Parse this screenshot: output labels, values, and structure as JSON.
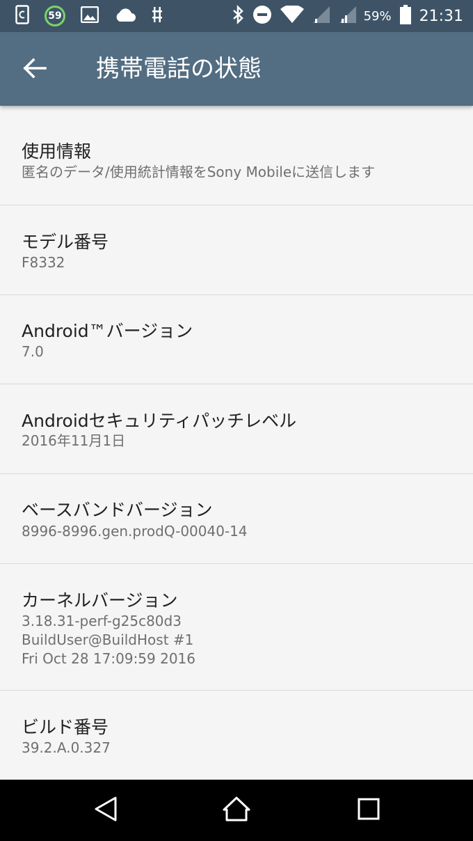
{
  "status_bar": {
    "notification_badge": "59",
    "battery_percent": "59%",
    "time": "21:31",
    "icons": [
      "screenshot-icon",
      "image-icon",
      "cloud-icon",
      "usb-debug-icon",
      "bluetooth-icon",
      "do-not-disturb-icon",
      "wifi-icon",
      "signal-icon",
      "signal-icon",
      "battery-icon"
    ]
  },
  "app_bar": {
    "title": "携帯電話の状態",
    "back_icon": "arrow-back-icon"
  },
  "items": [
    {
      "title": "使用情報",
      "summary": [
        "匿名のデータ/使用統計情報をSony Mobileに送信します"
      ]
    },
    {
      "title": "モデル番号",
      "summary": [
        "F8332"
      ]
    },
    {
      "title": "Android™バージョン",
      "summary": [
        "7.0"
      ]
    },
    {
      "title": "Androidセキュリティパッチレベル",
      "summary": [
        "2016年11月1日"
      ]
    },
    {
      "title": "ベースバンドバージョン",
      "summary": [
        "8996-8996.gen.prodQ-00040-14"
      ]
    },
    {
      "title": "カーネルバージョン",
      "summary": [
        "3.18.31-perf-g25c80d3",
        "BuildUser@BuildHost #1",
        "Fri Oct 28 17:09:59 2016"
      ]
    },
    {
      "title": "ビルド番号",
      "summary": [
        "39.2.A.0.327"
      ]
    }
  ],
  "nav_bar": {
    "icons": [
      "back-triangle-icon",
      "home-icon",
      "recents-icon"
    ]
  },
  "colors": {
    "status_bar": "#3e5466",
    "app_bar": "#536d82",
    "background": "#f5f5f5",
    "title_text": "#212121",
    "summary_text": "#6f6f6f",
    "divider": "#d9d9d9"
  }
}
